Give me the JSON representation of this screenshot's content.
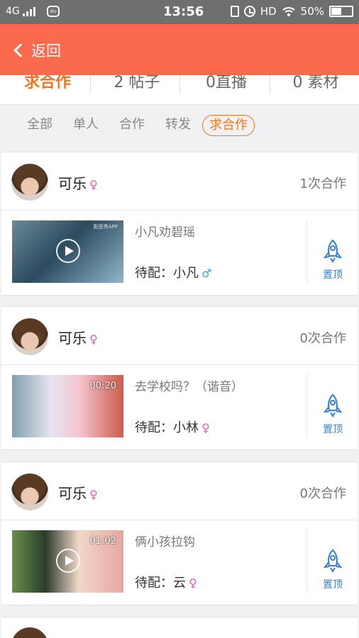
{
  "status_bar": {
    "network": "4G",
    "time": "13:56",
    "hd": "HD",
    "battery": "50%",
    "battery_level": 0.5
  },
  "header": {
    "back_label": "返回"
  },
  "stats": [
    "求合作",
    "2 帖子",
    "0直播",
    "0 素材"
  ],
  "filters": [
    "全部",
    "单人",
    "合作",
    "转发",
    "求合作"
  ],
  "active_filter": "求合作",
  "cards": [
    {
      "username": "可乐",
      "gender": "♀",
      "coop_count": "1次合作",
      "video_title": "小凡劝碧瑶",
      "duration": "",
      "watermark": "配音秀APP",
      "dub_prefix": "待配：",
      "dub_name": "小凡",
      "dub_gender": "♂",
      "pin_label": "置顶"
    },
    {
      "username": "可乐",
      "gender": "♀",
      "coop_count": "0次合作",
      "video_title": "去学校吗？（谐音）",
      "duration": "00:20",
      "watermark": "",
      "dub_prefix": "待配：",
      "dub_name": "小林",
      "dub_gender": "♀",
      "pin_label": "置顶"
    },
    {
      "username": "可乐",
      "gender": "♀",
      "coop_count": "0次合作",
      "video_title": "俩小孩拉钩",
      "duration": "01:02",
      "watermark": "",
      "dub_prefix": "待配：",
      "dub_name": "云",
      "dub_gender": "♀",
      "pin_label": "置顶"
    }
  ],
  "colors": {
    "accent": "#fc6a4d",
    "active_tab": "#f0771f",
    "pin": "#3a7fd0",
    "female": "#e15cb6",
    "male": "#3aa4d9"
  },
  "icons": {
    "back": "chevron-left-icon",
    "play": "play-icon",
    "pin": "rocket-icon"
  }
}
